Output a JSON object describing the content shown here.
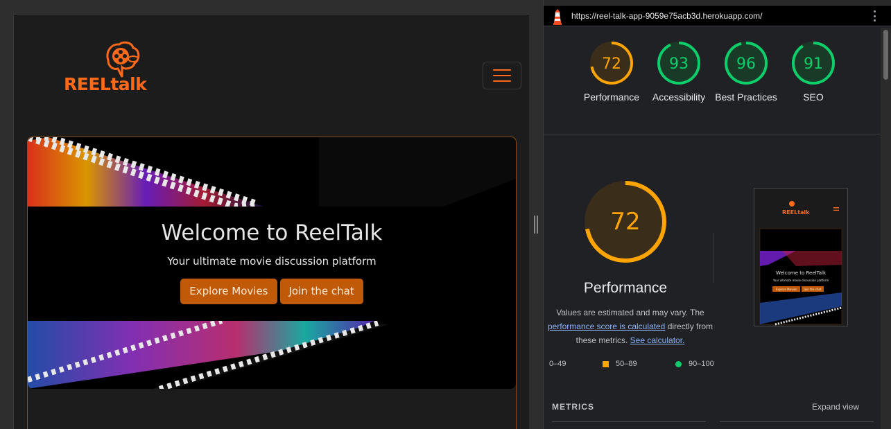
{
  "app": {
    "logo_text": "REELtalk",
    "hero": {
      "title": "Welcome to ReelTalk",
      "subtitle": "Your ultimate movie discussion platform",
      "btn_explore": "Explore Movies",
      "btn_chat": "Join the chat"
    },
    "menu_icon": "hamburger-icon"
  },
  "devtools": {
    "url": "https://reel-talk-app-9059e75acb3d.herokuapp.com/",
    "scores": [
      {
        "value": 72,
        "label": "Performance",
        "color": "#ffa400"
      },
      {
        "value": 93,
        "label": "Accessibility",
        "color": "#0cce6b"
      },
      {
        "value": 96,
        "label": "Best Practices",
        "color": "#0cce6b"
      },
      {
        "value": 91,
        "label": "SEO",
        "color": "#0cce6b"
      }
    ],
    "performance": {
      "score": 72,
      "title": "Performance",
      "desc_part1": "Values are estimated and may vary. The ",
      "link_score": "performance score is calculated",
      "desc_part2": " directly from these metrics. ",
      "link_calc": "See calculator."
    },
    "legend": {
      "fail": "0–49",
      "average": "50–89",
      "pass": "90–100"
    },
    "metrics_label": "METRICS",
    "expand_view": "Expand view",
    "thumbnail": {
      "logo_text": "REELtalk",
      "title": "Welcome to ReelTalk",
      "subtitle": "Your ultimate movie discussion platform",
      "btn_explore": "Explore Movies",
      "btn_chat": "Join the chat"
    }
  },
  "colors": {
    "brand_orange": "#ff6a1a",
    "button_orange": "#c05a08",
    "score_average": "#ffa400",
    "score_pass": "#0cce6b"
  }
}
